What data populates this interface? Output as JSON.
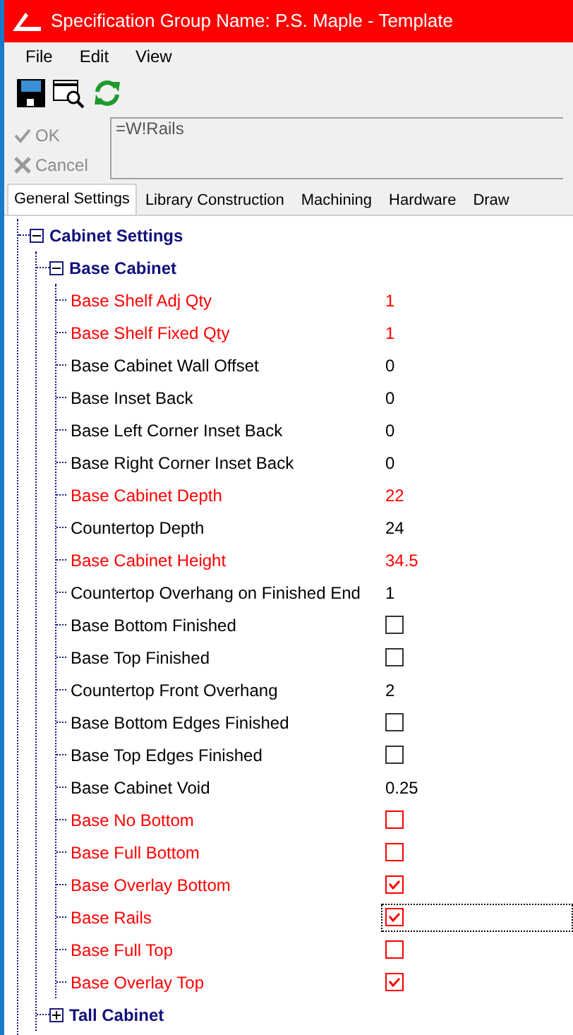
{
  "window": {
    "title": "Specification Group Name: P.S. Maple - Template"
  },
  "menu": [
    "File",
    "Edit",
    "View"
  ],
  "actions": [
    {
      "kind": "ok",
      "label": "OK",
      "disabled": true
    },
    {
      "kind": "cancel",
      "label": "Cancel",
      "disabled": true
    }
  ],
  "formula": {
    "value": "=W!Rails"
  },
  "tabs": [
    {
      "label": "General Settings",
      "selected": true
    },
    {
      "label": "Library Construction",
      "selected": false
    },
    {
      "label": "Machining",
      "selected": false
    },
    {
      "label": "Hardware",
      "selected": false
    },
    {
      "label": "Draw",
      "selected": false
    }
  ],
  "tree": [
    {
      "label": "Cabinet Settings",
      "expanded": true,
      "children": [
        {
          "label": "Base Cabinet",
          "expanded": true,
          "children": [
            {
              "label": "Base Shelf Adj Qty",
              "kind": "value",
              "value": "1",
              "modified": true,
              "focused": false
            },
            {
              "label": "Base Shelf Fixed Qty",
              "kind": "value",
              "value": "1",
              "modified": true,
              "focused": false
            },
            {
              "label": "Base Cabinet Wall Offset",
              "kind": "value",
              "value": "0",
              "modified": false,
              "focused": false
            },
            {
              "label": "Base Inset Back",
              "kind": "value",
              "value": "0",
              "modified": false,
              "focused": false
            },
            {
              "label": "Base Left Corner Inset Back",
              "kind": "value",
              "value": "0",
              "modified": false,
              "focused": false
            },
            {
              "label": "Base Right Corner Inset Back",
              "kind": "value",
              "value": "0",
              "modified": false,
              "focused": false
            },
            {
              "label": "Base Cabinet Depth",
              "kind": "value",
              "value": "22",
              "modified": true,
              "focused": false
            },
            {
              "label": "Countertop Depth",
              "kind": "value",
              "value": "24",
              "modified": false,
              "focused": false
            },
            {
              "label": "Base Cabinet Height",
              "kind": "value",
              "value": "34.5",
              "modified": true,
              "focused": false
            },
            {
              "label": "Countertop Overhang on Finished End",
              "kind": "value",
              "value": "1",
              "modified": false,
              "focused": false
            },
            {
              "label": "Base Bottom Finished",
              "kind": "checkbox",
              "checked": false,
              "modified": false,
              "focused": false
            },
            {
              "label": "Base Top Finished",
              "kind": "checkbox",
              "checked": false,
              "modified": false,
              "focused": false
            },
            {
              "label": "Countertop Front Overhang",
              "kind": "value",
              "value": "2",
              "modified": false,
              "focused": false
            },
            {
              "label": "Base Bottom Edges Finished",
              "kind": "checkbox",
              "checked": false,
              "modified": false,
              "focused": false
            },
            {
              "label": "Base Top Edges Finished",
              "kind": "checkbox",
              "checked": false,
              "modified": false,
              "focused": false
            },
            {
              "label": "Base Cabinet Void",
              "kind": "value",
              "value": "0.25",
              "modified": false,
              "focused": false
            },
            {
              "label": "Base No Bottom",
              "kind": "checkbox",
              "checked": false,
              "modified": true,
              "focused": false
            },
            {
              "label": "Base Full Bottom",
              "kind": "checkbox",
              "checked": false,
              "modified": true,
              "focused": false
            },
            {
              "label": "Base Overlay Bottom",
              "kind": "checkbox",
              "checked": true,
              "modified": true,
              "focused": false
            },
            {
              "label": "Base Rails",
              "kind": "checkbox",
              "checked": true,
              "modified": true,
              "focused": true
            },
            {
              "label": "Base Full Top",
              "kind": "checkbox",
              "checked": false,
              "modified": true,
              "focused": false
            },
            {
              "label": "Base Overlay Top",
              "kind": "checkbox",
              "checked": true,
              "modified": true,
              "focused": false
            }
          ]
        },
        {
          "label": "Tall Cabinet",
          "expanded": false
        }
      ]
    }
  ]
}
